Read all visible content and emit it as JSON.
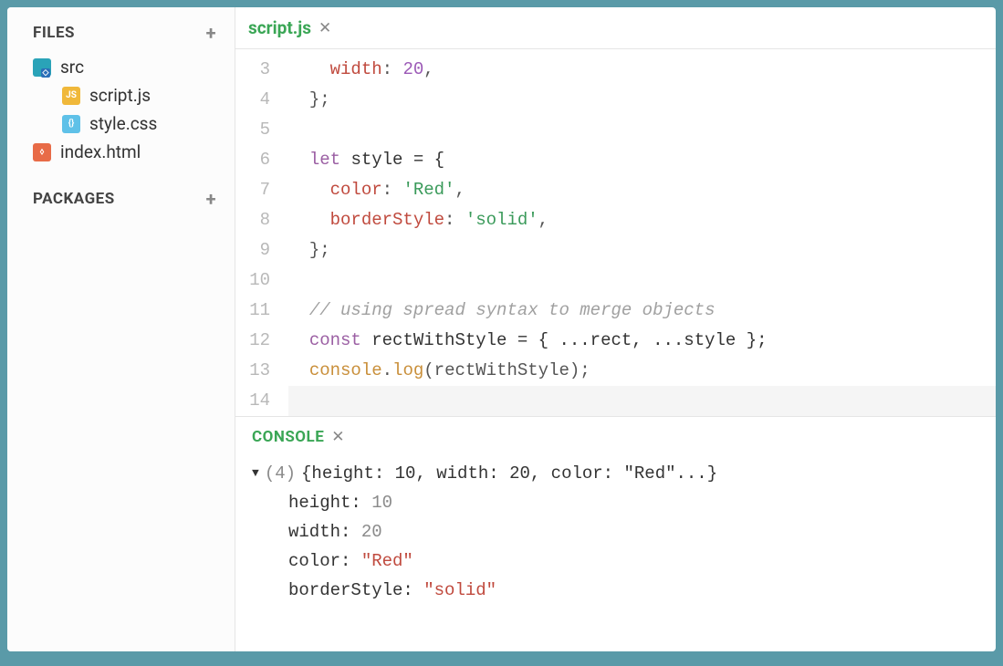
{
  "sidebar": {
    "files_label": "FILES",
    "packages_label": "PACKAGES",
    "tree": {
      "root": "src",
      "children": [
        {
          "name": "script.js",
          "icon": "js"
        },
        {
          "name": "style.css",
          "icon": "css"
        }
      ],
      "sibling": {
        "name": "index.html",
        "icon": "html"
      }
    }
  },
  "tab": {
    "label": "script.js"
  },
  "editor": {
    "first_line_number": 3,
    "lines": [
      [
        {
          "t": "indent",
          "v": "    "
        },
        {
          "t": "prop",
          "v": "width"
        },
        {
          "t": "punc",
          "v": ": "
        },
        {
          "t": "num",
          "v": "20"
        },
        {
          "t": "punc",
          "v": ","
        }
      ],
      [
        {
          "t": "indent",
          "v": "  "
        },
        {
          "t": "punc",
          "v": "};"
        }
      ],
      [],
      [
        {
          "t": "indent",
          "v": "  "
        },
        {
          "t": "kw",
          "v": "let"
        },
        {
          "t": "punc",
          "v": " "
        },
        {
          "t": "plain",
          "v": "style = {"
        }
      ],
      [
        {
          "t": "indent",
          "v": "    "
        },
        {
          "t": "prop",
          "v": "color"
        },
        {
          "t": "punc",
          "v": ": "
        },
        {
          "t": "str",
          "v": "'Red'"
        },
        {
          "t": "punc",
          "v": ","
        }
      ],
      [
        {
          "t": "indent",
          "v": "    "
        },
        {
          "t": "prop",
          "v": "borderStyle"
        },
        {
          "t": "punc",
          "v": ": "
        },
        {
          "t": "str",
          "v": "'solid'"
        },
        {
          "t": "punc",
          "v": ","
        }
      ],
      [
        {
          "t": "indent",
          "v": "  "
        },
        {
          "t": "punc",
          "v": "};"
        }
      ],
      [],
      [
        {
          "t": "indent",
          "v": "  "
        },
        {
          "t": "cmt",
          "v": "// using spread syntax to merge objects"
        }
      ],
      [
        {
          "t": "indent",
          "v": "  "
        },
        {
          "t": "kw",
          "v": "const"
        },
        {
          "t": "punc",
          "v": " "
        },
        {
          "t": "plain",
          "v": "rectWithStyle = { ...rect, ...style };"
        }
      ],
      [
        {
          "t": "indent",
          "v": "  "
        },
        {
          "t": "var",
          "v": "console"
        },
        {
          "t": "punc",
          "v": "."
        },
        {
          "t": "fn",
          "v": "log"
        },
        {
          "t": "punc",
          "v": "(rectWithStyle);"
        }
      ],
      []
    ],
    "current_line_index": 11
  },
  "console_panel": {
    "title": "CONSOLE",
    "summary_count": "(4)",
    "summary_text": "{height: 10, width: 20, color: \"Red\"...}",
    "entries": [
      {
        "key": "height",
        "value": "10",
        "type": "num"
      },
      {
        "key": "width",
        "value": "20",
        "type": "num"
      },
      {
        "key": "color",
        "value": "\"Red\"",
        "type": "str"
      },
      {
        "key": "borderStyle",
        "value": "\"solid\"",
        "type": "str"
      }
    ]
  }
}
